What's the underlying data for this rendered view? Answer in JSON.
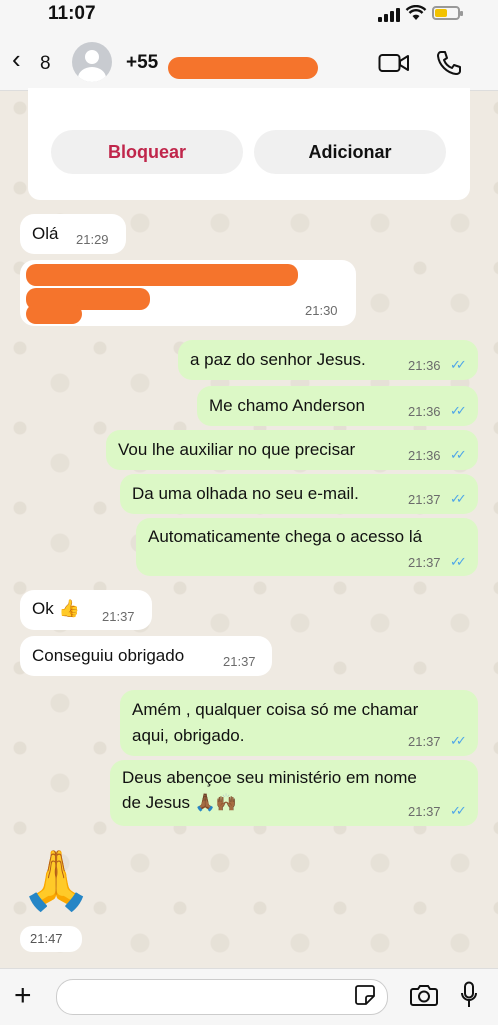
{
  "status_bar": {
    "time": "11:07"
  },
  "header": {
    "back_count": "8",
    "contact_number": "+55"
  },
  "info_card": {
    "block_label": "Bloquear",
    "add_label": "Adicionar"
  },
  "messages": [
    {
      "dir": "in",
      "text": "Olá",
      "time": "21:29"
    },
    {
      "dir": "in",
      "text": "",
      "time": "21:30"
    },
    {
      "dir": "out",
      "text": "a paz do senhor Jesus.",
      "time": "21:36"
    },
    {
      "dir": "out",
      "text": "Me chamo Anderson",
      "time": "21:36"
    },
    {
      "dir": "out",
      "text": "Vou lhe auxiliar no que precisar",
      "time": "21:36"
    },
    {
      "dir": "out",
      "text": "Da uma olhada no seu e-mail.",
      "time": "21:37"
    },
    {
      "dir": "out",
      "text": "Automaticamente chega o acesso lá",
      "time": "21:37"
    },
    {
      "dir": "in",
      "text": "Ok 👍",
      "time": "21:37"
    },
    {
      "dir": "in",
      "text": "Conseguiu obrigado",
      "time": "21:37"
    },
    {
      "dir": "out",
      "text": "Amém , qualquer coisa só me chamar",
      "text2": "aqui, obrigado.",
      "time": "21:37"
    },
    {
      "dir": "out",
      "text": "Deus abençoe seu ministério em nome",
      "text2": "de Jesus 🙏🏾🙌🏾",
      "time": "21:37"
    },
    {
      "dir": "in",
      "text": "🙏",
      "time": "21:47"
    }
  ],
  "read_ticks": "✓✓",
  "icons": [
    "chevron-left-icon",
    "video-icon",
    "phone-icon",
    "plus-icon",
    "sticker-icon",
    "camera-icon",
    "mic-icon"
  ]
}
